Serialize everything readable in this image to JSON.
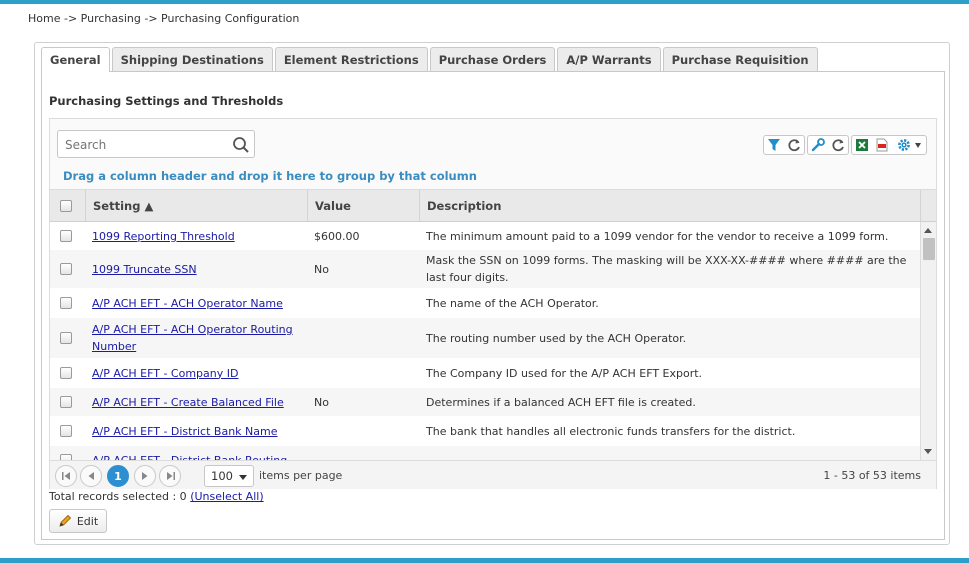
{
  "breadcrumb": "Home -> Purchasing -> Purchasing Configuration",
  "tabs": [
    {
      "label": "General",
      "active": true
    },
    {
      "label": "Shipping Destinations",
      "active": false
    },
    {
      "label": "Element Restrictions",
      "active": false
    },
    {
      "label": "Purchase Orders",
      "active": false
    },
    {
      "label": "A/P Warrants",
      "active": false
    },
    {
      "label": "Purchase Requisition",
      "active": false
    }
  ],
  "section_title": "Purchasing Settings and Thresholds",
  "search": {
    "placeholder": "Search",
    "value": ""
  },
  "toolbar": {
    "icons": [
      "filter-icon",
      "refresh-icon",
      "wrench-icon",
      "refresh-icon",
      "excel-icon",
      "pdf-icon",
      "gear-icon"
    ]
  },
  "group_hint": "Drag a column header and drop it here to group by that column",
  "columns": {
    "setting": "Setting ▲",
    "value": "Value",
    "description": "Description"
  },
  "rows": [
    {
      "setting": "1099 Reporting Threshold",
      "value": "$600.00",
      "description": "The minimum amount paid to a 1099 vendor for the vendor to receive a 1099 form."
    },
    {
      "setting": "1099 Truncate SSN",
      "value": "No",
      "description": "Mask the SSN on 1099 forms. The masking will be XXX-XX-#### where #### are the last four digits."
    },
    {
      "setting": "A/P ACH EFT - ACH Operator Name",
      "value": "",
      "description": "The name of the ACH Operator."
    },
    {
      "setting": "A/P ACH EFT - ACH Operator Routing Number",
      "value": "",
      "description": "The routing number used by the ACH Operator."
    },
    {
      "setting": "A/P ACH EFT - Company ID",
      "value": "",
      "description": "The Company ID used for the A/P ACH EFT Export."
    },
    {
      "setting": "A/P ACH EFT - Create Balanced File",
      "value": "No",
      "description": "Determines if a balanced ACH EFT file is created."
    },
    {
      "setting": "A/P ACH EFT - District Bank Name",
      "value": "",
      "description": "The bank that handles all electronic funds transfers for the district."
    },
    {
      "setting": "A/P ACH EFT - District Bank Routing",
      "value": "",
      "description": ""
    }
  ],
  "pager": {
    "current_page": "1",
    "page_size": "100",
    "items_per_page_label": "items per page",
    "info": "1 - 53 of 53 items"
  },
  "records": {
    "text": "Total records selected : 0 ",
    "unselect": "(Unselect All)"
  },
  "edit_button": {
    "label": "Edit"
  },
  "colors": {
    "accent": "#2e9fc9",
    "link": "#1a1aa6",
    "hint": "#3a8dc0",
    "page_active": "#2e8fd0"
  }
}
